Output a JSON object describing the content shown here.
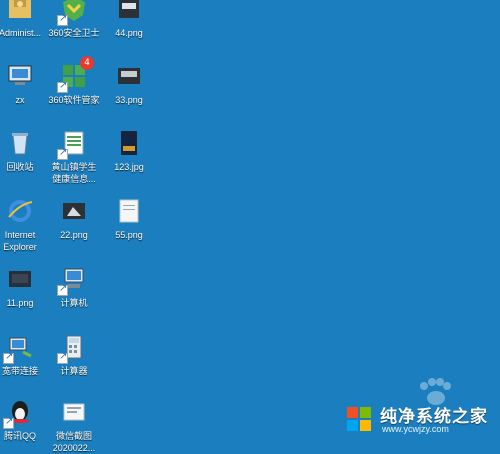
{
  "desktop": {
    "icons": [
      {
        "name": "administrator-folder-icon",
        "label": "Administ..."
      },
      {
        "name": "360-safe-icon",
        "label": "360安全卫士"
      },
      {
        "name": "png-44-icon",
        "label": "44.png"
      },
      {
        "name": "zx-computer-icon",
        "label": "zx"
      },
      {
        "name": "360-software-manager-icon",
        "label": "360软件管家",
        "badge": "4"
      },
      {
        "name": "png-33-icon",
        "label": "33.png"
      },
      {
        "name": "recycle-bin-icon",
        "label": "回收站"
      },
      {
        "name": "spreadsheet-icon",
        "label": "黄山镇学生\n健康信息..."
      },
      {
        "name": "jpg-123-icon",
        "label": "123.jpg"
      },
      {
        "name": "internet-explorer-icon",
        "label": "Internet\nExplorer"
      },
      {
        "name": "png-22-icon",
        "label": "22.png"
      },
      {
        "name": "png-55-icon",
        "label": "55.png"
      },
      {
        "name": "png-11-icon",
        "label": "11.png"
      },
      {
        "name": "computer-icon",
        "label": "计算机"
      },
      {
        "name": "broadband-connection-icon",
        "label": "宽带连接"
      },
      {
        "name": "calculator-icon",
        "label": "计算器"
      },
      {
        "name": "tencent-qq-icon",
        "label": "腾讯QQ"
      },
      {
        "name": "wechat-screenshot-icon",
        "label": "微信截图\n2020022..."
      }
    ]
  },
  "watermark": {
    "title": "纯净系统之家",
    "url": "www.ycwjzy.com"
  }
}
